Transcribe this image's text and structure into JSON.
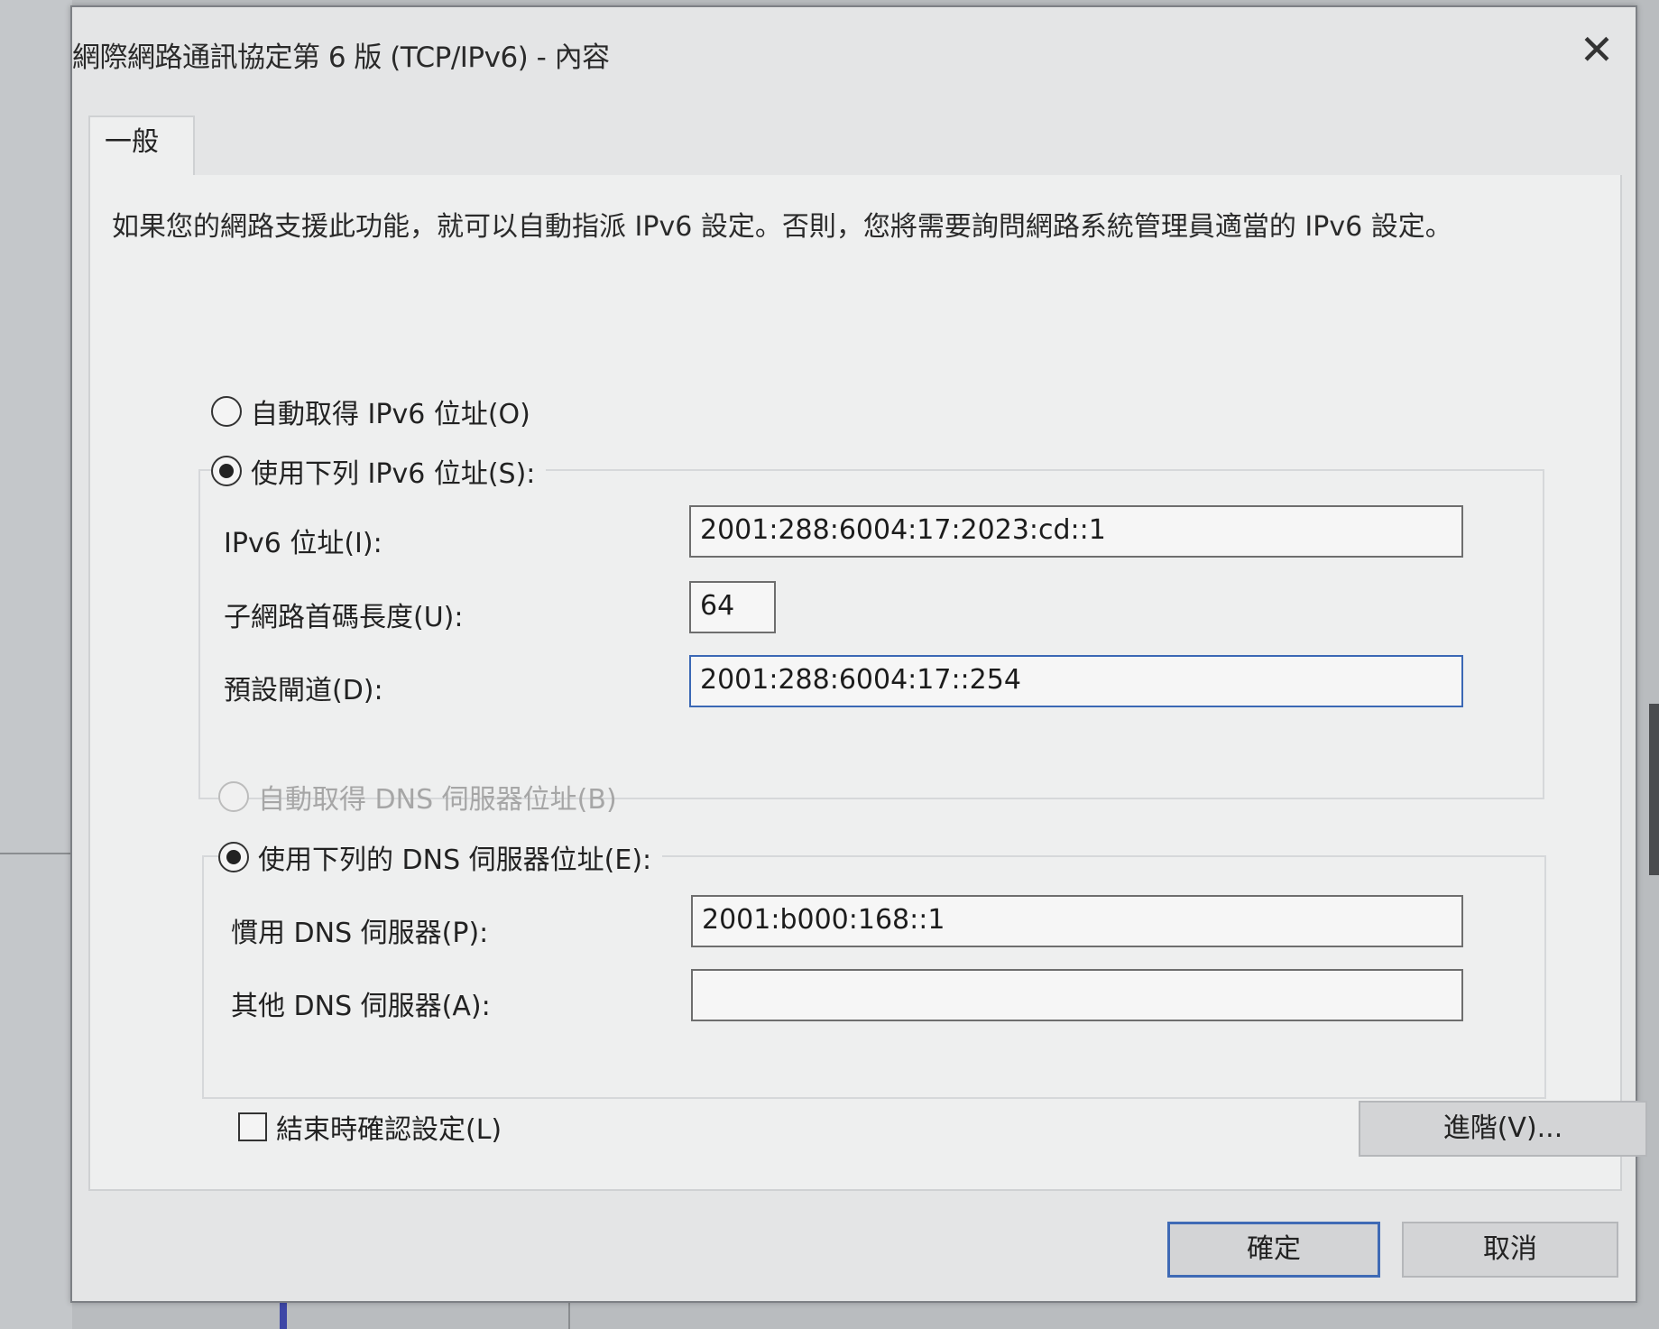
{
  "window": {
    "title": "網際網路通訊協定第 6 版 (TCP/IPv6) - 內容",
    "close_glyph": "✕"
  },
  "tabs": [
    {
      "label": "一般"
    }
  ],
  "description": "如果您的網路支援此功能，就可以自動指派 IPv6 設定。否則，您將需要詢問網路系統管理員適當的 IPv6 設定。",
  "ip_section": {
    "auto_label": "自動取得 IPv6 位址(O)",
    "auto_checked": false,
    "manual_label": "使用下列 IPv6 位址(S):",
    "manual_checked": true,
    "address_label": "IPv6 位址(I):",
    "address_value": "2001:288:6004:17:2023:cd::1",
    "prefix_label": "子網路首碼長度(U):",
    "prefix_value": "64",
    "gateway_label": "預設閘道(D):",
    "gateway_value": "2001:288:6004:17::254"
  },
  "dns_section": {
    "auto_label": "自動取得 DNS 伺服器位址(B)",
    "auto_enabled": false,
    "manual_label": "使用下列的 DNS 伺服器位址(E):",
    "manual_checked": true,
    "preferred_label": "慣用 DNS 伺服器(P):",
    "preferred_value": "2001:b000:168::1",
    "alternate_label": "其他 DNS 伺服器(A):",
    "alternate_value": ""
  },
  "validate_label": "結束時確認設定(L)",
  "validate_checked": false,
  "buttons": {
    "advanced": "進階(V)...",
    "ok": "確定",
    "cancel": "取消"
  }
}
